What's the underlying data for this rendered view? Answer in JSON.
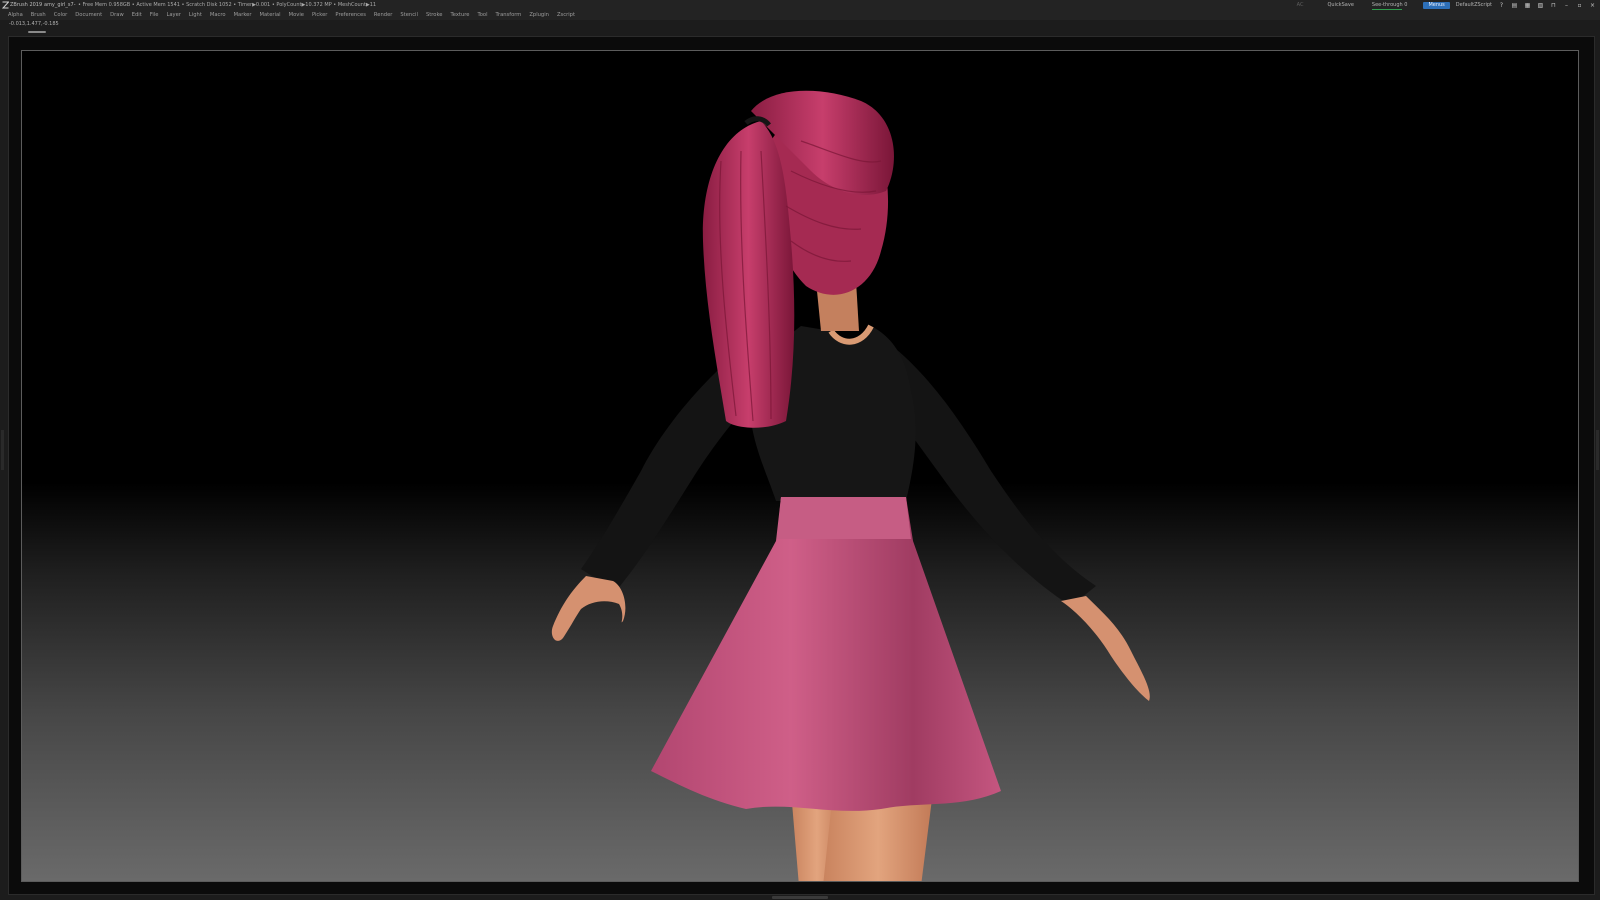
{
  "titlebar": {
    "app": "ZBrush 2019",
    "document": "amy_girl_s7-",
    "stats": "• Free Mem 0.958GB • Active Mem 1541 • Scratch Disk 1052 • Timer▶0.001 • PolyCount▶10.372 MP • MeshCount▶11",
    "ac": "AC",
    "quicksave": "QuickSave",
    "see_through": "See-through 0",
    "menus": "Menus",
    "script": "DefaultZScript"
  },
  "menubar": {
    "items": [
      "Alpha",
      "Brush",
      "Color",
      "Document",
      "Draw",
      "Edit",
      "File",
      "Layer",
      "Light",
      "Macro",
      "Marker",
      "Material",
      "Movie",
      "Picker",
      "Preferences",
      "Render",
      "Stencil",
      "Stroke",
      "Texture",
      "Tool",
      "Transform",
      "Zplugin",
      "Zscript"
    ]
  },
  "coords": "-0.013,1.477,-0.185",
  "viewport": {
    "subject": "3D sculpted cartoon girl seen from behind",
    "colors": {
      "hair": "#b3335c",
      "shirt": "#161616",
      "skirt": "#c0507a",
      "skin": "#d99a73"
    }
  }
}
